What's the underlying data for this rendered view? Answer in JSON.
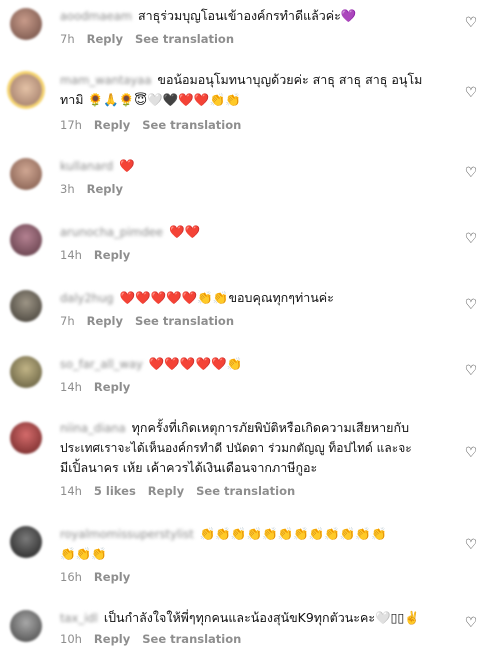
{
  "comments": [
    {
      "username": "aoodmaeam",
      "text": "สาธุร่วมบุญโอนเข้าองค์กรทำดีแล้วค่ะ💜",
      "time": "7h",
      "reply": "Reply",
      "translate": "See translation",
      "avatar_color": "#8b6a5e"
    },
    {
      "username": "mam_wantayaa",
      "text_line1": "ขอน้อมอนุโมทนาบุญด้วยค่ะ สาธุ สาธุ สาธุ อนุโม",
      "text_line2": "ทามิ 🌻🙏🌻😇🤍🖤❤️❤️👏👏",
      "time": "17h",
      "reply": "Reply",
      "translate": "See translation",
      "avatar_color": "#c9a489"
    },
    {
      "username": "kullanard",
      "text": "❤️",
      "time": "3h",
      "reply": "Reply",
      "avatar_color": "#a67d6c"
    },
    {
      "username": "arunocha_pimdee",
      "text": "❤️❤️",
      "time": "14h",
      "reply": "Reply",
      "avatar_color": "#7a4e5a"
    },
    {
      "username": "daly2hug",
      "text": "❤️❤️❤️❤️❤️👏👏ขอบคุณทุกๆท่านค่ะ",
      "time": "7h",
      "reply": "Reply",
      "translate": "See translation",
      "avatar_color": "#5f5a52"
    },
    {
      "username": "so_far_all_way",
      "text": "❤️❤️❤️❤️❤️👏",
      "time": "14h",
      "reply": "Reply",
      "avatar_color": "#7e7a62"
    },
    {
      "username": "niina_diana",
      "text_line1": "ทุกครั้งที่เกิดเหตุการภัยพิบัติหรือเกิดความเสียหายกับ",
      "text_line2": "ประเทศเราจะได้เห็นองค์กรทำดี ปนัดดา ร่วมกตัญญู ท็อปไทด์ และจะ",
      "text_line3": "มีเปิ้ลนาคร เห้ย เค้าควรได้เงินเดือนจากภาษีกูอะ",
      "time": "14h",
      "likes": "5 likes",
      "reply": "Reply",
      "translate": "See translation",
      "avatar_color": "#9a3b3b"
    },
    {
      "username": "royalmomissuperstylist",
      "text_line1": "👏👏👏👏👏👏👏👏👏👏👏👏",
      "text_line2": "👏👏👏",
      "time": "16h",
      "reply": "Reply",
      "avatar_color": "#3a3a3a"
    },
    {
      "username": "tax_idl",
      "text": "เป็นกำลังใจให้พี่ๆทุกคนและน้องสุนัขK9ทุกตัวนะคะ🤍▯▯✌️",
      "time": "10h",
      "reply": "Reply",
      "translate": "See translation",
      "avatar_color": "#6e6e6e"
    }
  ],
  "icons": {
    "like": "heart-outline-icon"
  }
}
